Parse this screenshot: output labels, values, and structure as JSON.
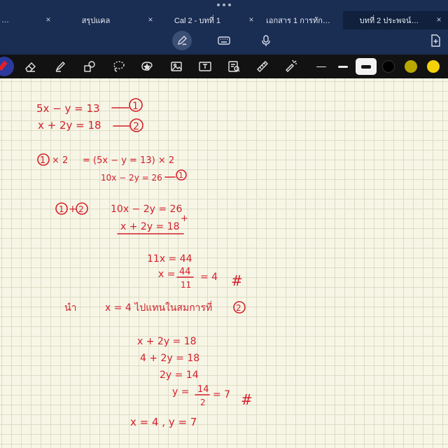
{
  "tabs": [
    {
      "label": "…"
    },
    {
      "label": "สรุปแคล"
    },
    {
      "label": "Cal 2 - บทที่ 1"
    },
    {
      "label": "เอกสาร 1 การทัก…"
    },
    {
      "label": "บทที่ 2 ประพจน์…"
    }
  ],
  "tab_close_glyph": "×",
  "colors": {
    "ink": "#d51f2a",
    "swatch_black": "#000000",
    "swatch_olive": "#b8a800",
    "swatch_yellow": "#f4d20a"
  },
  "toolbar_icons": [
    "pencil-icon",
    "keyboard-icon",
    "microphone-icon",
    "add-page-icon"
  ],
  "tools": [
    "pen-tool",
    "eraser",
    "highlighter",
    "shapes",
    "lasso",
    "sticker",
    "image",
    "text",
    "scan",
    "ruler",
    "laser-pointer"
  ],
  "note": {
    "l1": "5x − y = 13",
    "l1_tag": "1",
    "l2": "x + 2y = 18",
    "l2_tag": "2",
    "l3_tag": "1",
    "l3": "× 2",
    "l3b": "= (5x − y = 13) × 2",
    "l4": "10x − 2y = 26",
    "l4_tag": "1",
    "l5_tag1": "1",
    "l5_plus": "+",
    "l5_tag2": "2",
    "l5": "10x − 2y = 26",
    "l6": "x + 2y = 18",
    "l6_plus": "+",
    "l7": "11x = 44",
    "l8a": "x =",
    "l8_num": "44",
    "l8_den": "11",
    "l8b": "= 4",
    "l8_hash": "#",
    "l9a": "นำ",
    "l9b": "x = 4  ไปแทนในสมการที่",
    "l9_tag": "2",
    "l10": "x + 2y = 18",
    "l11": "4 + 2y = 18",
    "l12": "2y = 14",
    "l13a": "y =",
    "l13_num": "14",
    "l13_den": "2",
    "l13b": "= 7",
    "l13_hash": "#",
    "l14": "x = 4 , y = 7"
  }
}
